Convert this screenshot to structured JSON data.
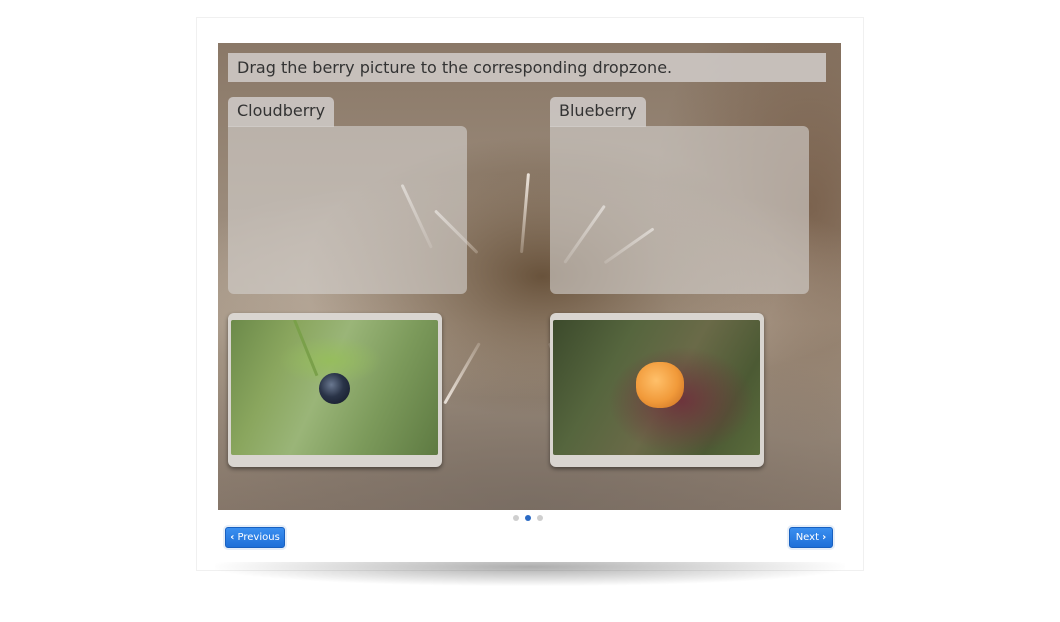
{
  "task": {
    "instruction": "Drag the berry picture to the corresponding dropzone."
  },
  "dropzones": [
    {
      "label": "Cloudberry"
    },
    {
      "label": "Blueberry"
    }
  ],
  "draggables": [
    {
      "image": "blueberry-photo"
    },
    {
      "image": "cloudberry-photo"
    }
  ],
  "pagination": {
    "total": 3,
    "current": 2
  },
  "nav": {
    "previous_icon": "‹",
    "previous_label": "Previous",
    "next_label": "Next",
    "next_icon": "›"
  },
  "colors": {
    "button_blue": "#1e6fd8",
    "active_dot": "#2b6ac4"
  }
}
